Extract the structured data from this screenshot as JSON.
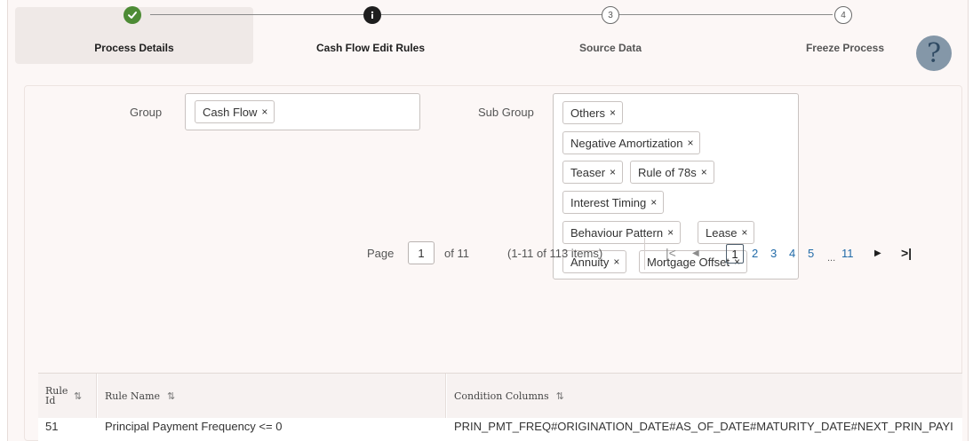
{
  "train": {
    "steps": [
      {
        "label": "Process Details",
        "state": "done",
        "number": ""
      },
      {
        "label": "Cash Flow Edit Rules",
        "state": "current",
        "number": ""
      },
      {
        "label": "Source Data",
        "state": "todo",
        "number": "3"
      },
      {
        "label": "Freeze Process",
        "state": "todo",
        "number": "4"
      }
    ],
    "help_label": "?"
  },
  "filters": {
    "group_label": "Group",
    "group_chips": [
      "Cash Flow"
    ],
    "subgroup_label": "Sub Group",
    "subgroup_chips": [
      "Others",
      "Negative Amortization",
      "Teaser",
      "Rule of 78s",
      "Interest Timing",
      "Behaviour Pattern",
      "Lease",
      "Annuity",
      "Mortgage Offset"
    ],
    "chip_remove_glyph": "×"
  },
  "pagination": {
    "page_label": "Page",
    "page_value": "1",
    "of_label": "of 11",
    "range_label": "(1-11 of 113 items)",
    "pages": [
      "1",
      "2",
      "3",
      "4",
      "5"
    ],
    "ellipsis": "...",
    "last_page": "11",
    "current_page": "1"
  },
  "table": {
    "columns": [
      {
        "label": "Rule Id"
      },
      {
        "label": "Rule Name"
      },
      {
        "label": "Condition Columns"
      }
    ],
    "rows": [
      {
        "rule_id": "51",
        "rule_name": "Principal Payment Frequency <= 0",
        "condition_columns": "PRIN_PMT_FREQ#ORIGINATION_DATE#AS_OF_DATE#MATURITY_DATE#NEXT_PRIN_PAYI"
      }
    ]
  },
  "colors": {
    "done": "#4d8b35",
    "link": "#226ba8",
    "help": "#8497a8"
  }
}
